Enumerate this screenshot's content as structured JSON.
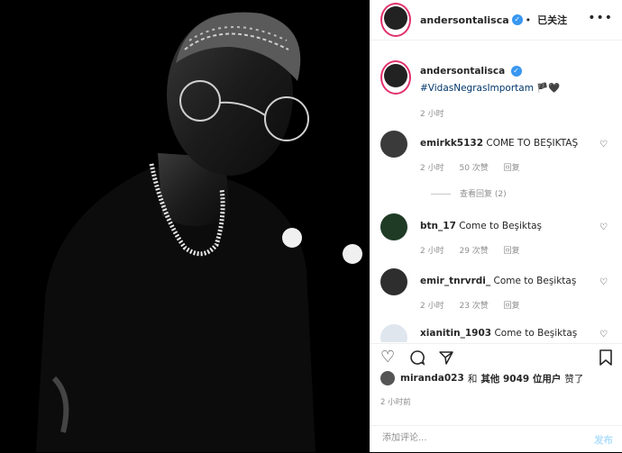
{
  "header": {
    "username": "andersontalisca",
    "verified_mark": "✓",
    "follow_status": "已关注",
    "separator": "•",
    "more_icon": "more-horizontal-icon"
  },
  "caption": {
    "username": "andersontalisca",
    "text": "#VidasNegrasImportam 🏴🖤",
    "time": "2 小时"
  },
  "comments": [
    {
      "username": "emirkk5132",
      "text": "COME TO BEŞIKTAŞ",
      "time": "2 小时",
      "likes": "50 次赞",
      "reply": "回复",
      "view_replies": "查看回复 (2)"
    },
    {
      "username": "btn_17",
      "text": "Come to Beşiktaş",
      "time": "2 小时",
      "likes": "29 次赞",
      "reply": "回复"
    },
    {
      "username": "emir_tnrvrdi_",
      "text": "Come to Beşiktaş",
      "time": "2 小时",
      "likes": "23 次赞",
      "reply": "回复"
    },
    {
      "username": "xianitin_1903",
      "text": "Come to Beşiktaş",
      "time": "",
      "likes": "",
      "reply": ""
    }
  ],
  "likes": {
    "user": "miranda023",
    "connector": "和",
    "others": "其他 9049 位用户",
    "suffix": "赞了"
  },
  "post_time": "2 小时前",
  "add_comment": {
    "placeholder": "添加评论...",
    "post_label": "发布"
  },
  "colors": {
    "accent": "#3897f0",
    "muted": "#8e8e8e",
    "post_disabled": "#b2dffc"
  }
}
